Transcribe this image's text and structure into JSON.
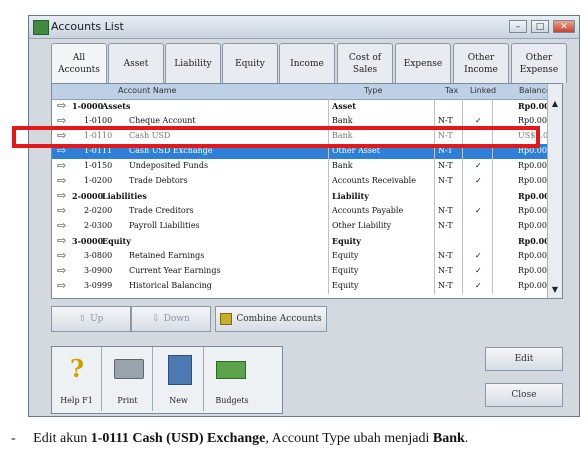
{
  "window": {
    "title": "Accounts List"
  },
  "tabs": [
    {
      "label": "All\nAccounts"
    },
    {
      "label": "Asset"
    },
    {
      "label": "Liability"
    },
    {
      "label": "Equity"
    },
    {
      "label": "Income"
    },
    {
      "label": "Cost of\nSales"
    },
    {
      "label": "Expense"
    },
    {
      "label": "Other\nIncome"
    },
    {
      "label": "Other\nExpense"
    }
  ],
  "grid": {
    "columns": {
      "name": "Account Name",
      "type": "Type",
      "tax": "Tax",
      "linked": "Linked",
      "balance": "Balance"
    },
    "rows": [
      {
        "num": "1-0000",
        "name": "Assets",
        "type": "Asset",
        "tax": "",
        "linked": "",
        "balance": "Rp0.00"
      },
      {
        "num": "1-0100",
        "name": "Cheque Account",
        "type": "Bank",
        "tax": "N-T",
        "linked": "✓",
        "balance": "Rp0.00"
      },
      {
        "num": "1-0110",
        "name": "Cash USD",
        "type": "Bank",
        "tax": "N-T",
        "linked": "",
        "balance": "US$0.00"
      },
      {
        "num": "1-0111",
        "name": "Cash USD Exchange",
        "type": "Other Asset",
        "tax": "N-T",
        "linked": "",
        "balance": "Rp0.00"
      },
      {
        "num": "1-0150",
        "name": "Undeposited Funds",
        "type": "Bank",
        "tax": "N-T",
        "linked": "✓",
        "balance": "Rp0.00"
      },
      {
        "num": "1-0200",
        "name": "Trade Debtors",
        "type": "Accounts Receivable",
        "tax": "N-T",
        "linked": "✓",
        "balance": "Rp0.00"
      },
      {
        "num": "2-0000",
        "name": "Liabilities",
        "type": "Liability",
        "tax": "",
        "linked": "",
        "balance": "Rp0.00"
      },
      {
        "num": "2-0200",
        "name": "Trade Creditors",
        "type": "Accounts Payable",
        "tax": "N-T",
        "linked": "✓",
        "balance": "Rp0.00"
      },
      {
        "num": "2-0300",
        "name": "Payroll Liabilities",
        "type": "Other Liability",
        "tax": "N-T",
        "linked": "",
        "balance": "Rp0.00"
      },
      {
        "num": "3-0000",
        "name": "Equity",
        "type": "Equity",
        "tax": "",
        "linked": "",
        "balance": "Rp0.00"
      },
      {
        "num": "3-0800",
        "name": "Retained Earnings",
        "type": "Equity",
        "tax": "N-T",
        "linked": "✓",
        "balance": "Rp0.00"
      },
      {
        "num": "3-0900",
        "name": "Current Year Earnings",
        "type": "Equity",
        "tax": "N-T",
        "linked": "✓",
        "balance": "Rp0.00"
      },
      {
        "num": "3-0999",
        "name": "Historical Balancing",
        "type": "Equity",
        "tax": "N-T",
        "linked": "✓",
        "balance": "Rp0.00"
      }
    ]
  },
  "buttons": {
    "up": "Up",
    "down": "Down",
    "combine": "Combine Accounts",
    "help": "Help F1",
    "print": "Print",
    "new": "New",
    "budgets": "Budgets",
    "edit": "Edit",
    "close": "Close"
  },
  "caption": {
    "bullet": "-",
    "pre": "Edit akun ",
    "bold1": "1-0111 Cash (USD) Exchange",
    "mid": ", Account Type ubah menjadi ",
    "bold2": "Bank",
    "post": "."
  },
  "colors": {
    "selected": "#2e7fd6",
    "highlight_box": "#e4171b",
    "header": "#bdd0e6"
  }
}
